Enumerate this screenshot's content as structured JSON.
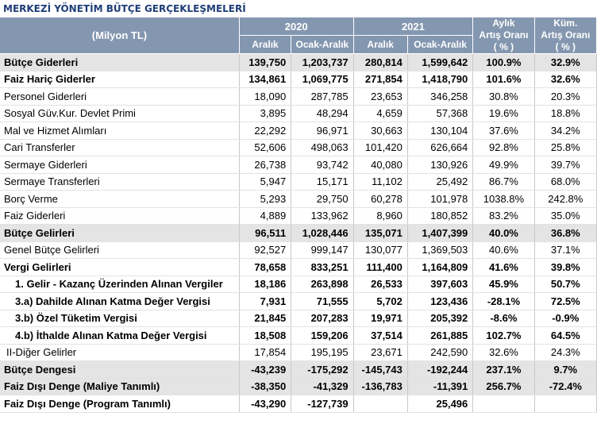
{
  "title": "MERKEZİ YÖNETİM BÜTÇE GERÇEKLEŞMELERİ",
  "header": {
    "unit": "(Milyon TL)",
    "year1": "2020",
    "year2": "2021",
    "monthly_line1": "Aylık",
    "monthly_line2": "Artış Oranı",
    "monthly_line3": "( % )",
    "cum_line1": "Küm.",
    "cum_line2": "Artış Oranı",
    "cum_line3": "( % )",
    "sub_a": "Aralık",
    "sub_b": "Ocak-Aralık",
    "sub_c": "Aralık",
    "sub_d": "Ocak-Aralık"
  },
  "rows": [
    {
      "label": "Bütçe Giderleri",
      "v": [
        "139,750",
        "1,203,737",
        "280,814",
        "1,599,642",
        "100.9%",
        "32.9%"
      ]
    },
    {
      "label": "Faiz Hariç Giderler",
      "v": [
        "134,861",
        "1,069,775",
        "271,854",
        "1,418,790",
        "101.6%",
        "32.6%"
      ]
    },
    {
      "label": "Personel Giderleri",
      "v": [
        "18,090",
        "287,785",
        "23,653",
        "346,258",
        "30.8%",
        "20.3%"
      ]
    },
    {
      "label": "Sosyal Güv.Kur. Devlet Primi",
      "v": [
        "3,895",
        "48,294",
        "4,659",
        "57,368",
        "19.6%",
        "18.8%"
      ]
    },
    {
      "label": "Mal ve Hizmet Alımları",
      "v": [
        "22,292",
        "96,971",
        "30,663",
        "130,104",
        "37.6%",
        "34.2%"
      ]
    },
    {
      "label": "Cari Transferler",
      "v": [
        "52,606",
        "498,063",
        "101,420",
        "626,664",
        "92.8%",
        "25.8%"
      ]
    },
    {
      "label": "Sermaye Giderleri",
      "v": [
        "26,738",
        "93,742",
        "40,080",
        "130,926",
        "49.9%",
        "39.7%"
      ]
    },
    {
      "label": "Sermaye Transferleri",
      "v": [
        "5,947",
        "15,171",
        "11,102",
        "25,492",
        "86.7%",
        "68.0%"
      ]
    },
    {
      "label": "Borç Verme",
      "v": [
        "5,293",
        "29,750",
        "60,278",
        "101,978",
        "1038.8%",
        "242.8%"
      ]
    },
    {
      "label": "Faiz Giderleri",
      "v": [
        "4,889",
        "133,962",
        "8,960",
        "180,852",
        "83.2%",
        "35.0%"
      ]
    },
    {
      "label": "Bütçe Gelirleri",
      "v": [
        "96,511",
        "1,028,446",
        "135,071",
        "1,407,399",
        "40.0%",
        "36.8%"
      ]
    },
    {
      "label": "Genel Bütçe Gelirleri",
      "v": [
        "92,527",
        "999,147",
        "130,077",
        "1,369,503",
        "40.6%",
        "37.1%"
      ]
    },
    {
      "label": "Vergi Gelirleri",
      "v": [
        "78,658",
        "833,251",
        "111,400",
        "1,164,809",
        "41.6%",
        "39.8%"
      ]
    },
    {
      "label": "1. Gelir - Kazanç Üzerinden Alınan Vergiler",
      "v": [
        "18,186",
        "263,898",
        "26,533",
        "397,603",
        "45.9%",
        "50.7%"
      ]
    },
    {
      "label": "3.a) Dahilde Alınan Katma Değer Vergisi",
      "v": [
        "7,931",
        "71,555",
        "5,702",
        "123,436",
        "-28.1%",
        "72.5%"
      ]
    },
    {
      "label": "3.b) Özel Tüketim Vergisi",
      "v": [
        "21,845",
        "207,283",
        "19,971",
        "205,392",
        "-8.6%",
        "-0.9%"
      ]
    },
    {
      "label": "4.b) İthalde Alınan Katma Değer Vergisi",
      "v": [
        "18,508",
        "159,206",
        "37,514",
        "261,885",
        "102.7%",
        "64.5%"
      ]
    },
    {
      "label": "II-Diğer Gelirler",
      "v": [
        "17,854",
        "195,195",
        "23,671",
        "242,590",
        "32.6%",
        "24.3%"
      ]
    },
    {
      "label": "Bütçe Dengesi",
      "v": [
        "-43,239",
        "-175,292",
        "-145,743",
        "-192,244",
        "237.1%",
        "9.7%"
      ]
    },
    {
      "label": "Faiz Dışı Denge (Maliye Tanımlı)",
      "v": [
        "-38,350",
        "-41,329",
        "-136,783",
        "-11,391",
        "256.7%",
        "-72.4%"
      ]
    },
    {
      "label": "Faiz Dışı Denge (Program Tanımlı)",
      "v": [
        "-43,290",
        "-127,739",
        "",
        "25,496",
        "",
        ""
      ]
    }
  ]
}
